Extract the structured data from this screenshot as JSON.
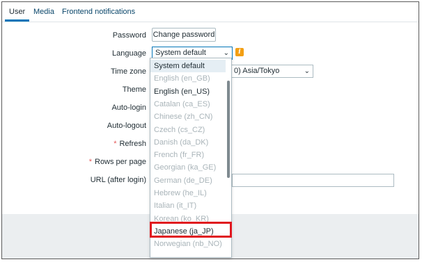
{
  "tabs": [
    {
      "label": "User",
      "active": true
    },
    {
      "label": "Media",
      "active": false
    },
    {
      "label": "Frontend notifications",
      "active": false
    }
  ],
  "form": {
    "password_label": "Password",
    "change_password_button": "Change password",
    "language_label": "Language",
    "language_value": "System default",
    "timezone_label": "Time zone",
    "timezone_value": "0) Asia/Tokyo",
    "theme_label": "Theme",
    "autologin_label": "Auto-login",
    "autologout_label": "Auto-logout",
    "refresh_label": "Refresh",
    "rows_label": "Rows per page",
    "url_label": "URL (after login)",
    "required_mark": "*"
  },
  "dropdown": {
    "items": [
      {
        "label": "System default",
        "state": "selected"
      },
      {
        "label": "English (en_GB)",
        "state": "disabled"
      },
      {
        "label": "English (en_US)",
        "state": "enabled"
      },
      {
        "label": "Catalan (ca_ES)",
        "state": "disabled"
      },
      {
        "label": "Chinese (zh_CN)",
        "state": "disabled"
      },
      {
        "label": "Czech (cs_CZ)",
        "state": "disabled"
      },
      {
        "label": "Danish (da_DK)",
        "state": "disabled"
      },
      {
        "label": "French (fr_FR)",
        "state": "disabled"
      },
      {
        "label": "Georgian (ka_GE)",
        "state": "disabled"
      },
      {
        "label": "German (de_DE)",
        "state": "disabled"
      },
      {
        "label": "Hebrew (he_IL)",
        "state": "disabled"
      },
      {
        "label": "Italian (it_IT)",
        "state": "disabled"
      },
      {
        "label": "Korean (ko_KR)",
        "state": "disabled"
      },
      {
        "label": "Japanese (ja_JP)",
        "state": "enabled"
      },
      {
        "label": "Norwegian (nb_NO)",
        "state": "disabled"
      }
    ],
    "highlighted": "Japanese (ja_JP)"
  },
  "icons": {
    "chevron": "chevron-down-icon",
    "info": "info-icon",
    "info_glyph": "i"
  },
  "colors": {
    "accent": "#0275b8",
    "highlight_box": "#e0161e",
    "info_icon": "#f39f14",
    "required": "#e45959"
  }
}
